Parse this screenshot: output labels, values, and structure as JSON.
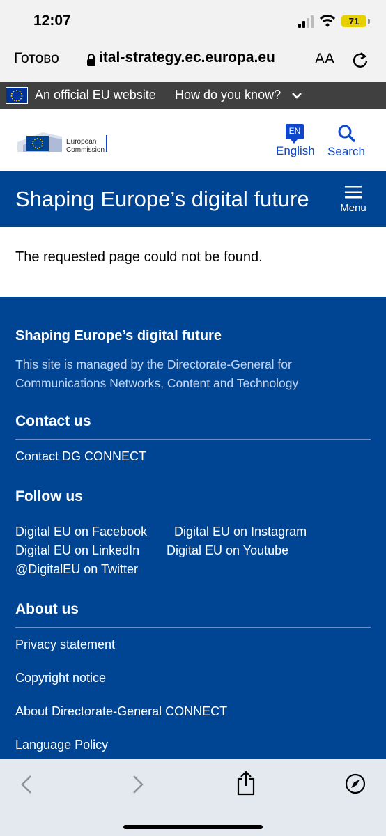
{
  "status": {
    "time": "12:07",
    "battery": "71"
  },
  "browser": {
    "done_label": "Готово",
    "url": "ital-strategy.ec.europa.eu",
    "text_size_label": "AA"
  },
  "eu_banner": {
    "official": "An official EU website",
    "how_know": "How do you know?"
  },
  "ec_header": {
    "logo_line1": "European",
    "logo_line2": "Commission",
    "lang_code": "EN",
    "lang_label": "English",
    "search_label": "Search"
  },
  "site": {
    "title": "Shaping Europe’s digital future",
    "menu_label": "Menu"
  },
  "main": {
    "message": "The requested page could not be found."
  },
  "footer": {
    "title": "Shaping Europe’s digital future",
    "description": "This site is managed by the Directorate-General for Communications Networks, Content and Technology",
    "contact_heading": "Contact us",
    "contact_link": "Contact DG CONNECT",
    "follow_heading": "Follow us",
    "follow_links": [
      "Digital EU on Facebook",
      "Digital EU on Instagram",
      "Digital EU on LinkedIn",
      "Digital EU on Youtube",
      "@DigitalEU on Twitter"
    ],
    "about_heading": "About us",
    "about_links": [
      "Privacy statement",
      "Copyright notice",
      "About Directorate-General CONNECT",
      "Language Policy"
    ]
  },
  "colors": {
    "eu_blue": "#004494",
    "link_blue": "#0e47cb",
    "banner_grey": "#404040"
  }
}
